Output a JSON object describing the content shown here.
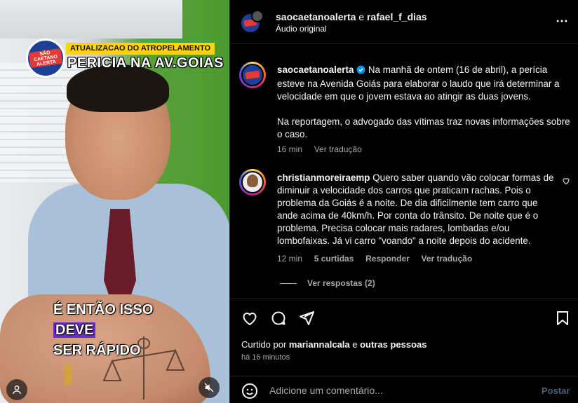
{
  "video": {
    "badge_text": "SÃO CAETANO ALERTA",
    "tag_label": "ATUALIZACAO DO ATROPELAMENTO",
    "headline": "PERICIA NA AV.GOIAS",
    "caption_pre": "É ENTÃO ISSO ",
    "caption_highlight": "DEVE",
    "caption_line2": "SER RÁPIDO",
    "user_icon": "user-icon",
    "mute_icon": "speaker-muted-icon"
  },
  "header": {
    "user1": "saocaetanoalerta",
    "connector": " e ",
    "user2": "rafael_f_dias",
    "audio": "Áudio original",
    "more_icon": "more-horizontal-icon"
  },
  "post": {
    "author": "saocaetanoalerta",
    "verified_icon": "verified-badge-icon",
    "paragraph1": "Na manhã de ontem (16 de abril), a perícia esteve na Avenida Goiás para elaborar o laudo que irá determinar a velocidade em que o jovem estava ao atingir as duas jovens.",
    "paragraph2": "Na reportagem, o advogado das vítimas traz novas informações sobre o caso.",
    "time": "16 min",
    "translate": "Ver tradução"
  },
  "comment": {
    "author": "christianmoreiraemp",
    "text": "Quero saber quando vão colocar formas de diminuir a velocidade dos carros que praticam rachas. Pois o problema da Goiás é a noite. De dia dificilmente tem carro que ande acima de 40km/h. Por conta do trânsito. De noite que é o problema. Precisa colocar mais radares, lombadas e/ou lombofaixas. Já vi carro \"voando\" a noite depois do acidente.",
    "time": "12 min",
    "likes": "5 curtidas",
    "reply": "Responder",
    "translate": "Ver tradução",
    "view_replies": "Ver respostas (2)",
    "like_icon": "heart-outline-icon"
  },
  "actions": {
    "like_icon": "heart-icon",
    "comment_icon": "comment-icon",
    "share_icon": "send-icon",
    "save_icon": "bookmark-icon",
    "liked_by_prefix": "Curtido por ",
    "liked_by_user": "mariannalcala",
    "liked_by_mid": " e ",
    "liked_by_others": "outras pessoas",
    "post_time": "há 16 minutos"
  },
  "add_comment": {
    "emoji_icon": "emoji-icon",
    "placeholder": "Adicione um comentário...",
    "post_label": "Postar"
  },
  "colors": {
    "background": "#000000",
    "text": "#f5f5f5",
    "muted": "#a8a8a8",
    "link_blue": "#0095f6",
    "post_disabled": "#4a5d79"
  }
}
